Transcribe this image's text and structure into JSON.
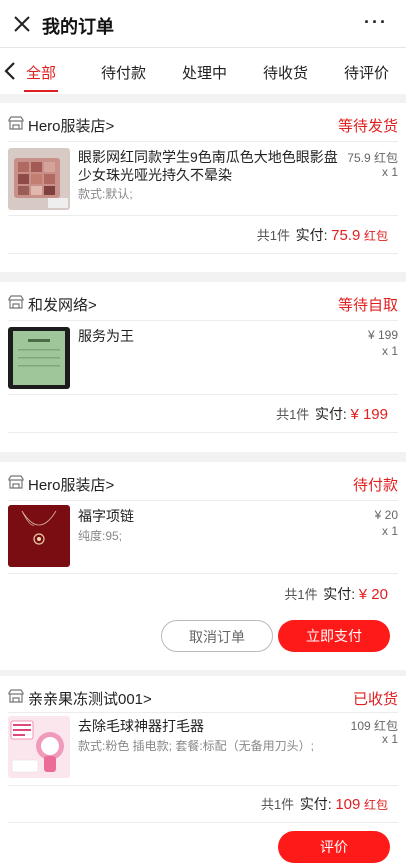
{
  "header": {
    "title": "我的订单",
    "close_icon": "close-icon",
    "more_label": "···"
  },
  "tabs": {
    "back_icon": "chevron-left-icon",
    "items": [
      {
        "label": "全部",
        "active": true
      },
      {
        "label": "待付款",
        "active": false
      },
      {
        "label": "处理中",
        "active": false
      },
      {
        "label": "待收货",
        "active": false
      },
      {
        "label": "待评价",
        "active": false
      }
    ]
  },
  "orders": [
    {
      "shop": "Hero服装店>",
      "status": "等待发货",
      "product": "眼影网红同款学生9色南瓜色大地色眼影盘少女珠光哑光持久不晕染",
      "attr": "款式:默认;",
      "price": "75.9 红包",
      "qty": "x 1",
      "count": "共1件",
      "paid_label": "实付:",
      "amount": "75.9",
      "unit": "红包"
    },
    {
      "shop": "和发网络>",
      "status": "等待自取",
      "product": "服务为王",
      "attr": "",
      "price": "¥ 199",
      "qty": "x 1",
      "count": "共1件",
      "paid_label": "实付:",
      "amount": "¥ 199",
      "unit": ""
    },
    {
      "shop": "Hero服装店>",
      "status": "待付款",
      "product": "福字项链",
      "attr": "纯度:95;",
      "price": "¥ 20",
      "qty": "x 1",
      "count": "共1件",
      "paid_label": "实付:",
      "amount": "¥ 20",
      "unit": "",
      "buttons": {
        "cancel": "取消订单",
        "pay": "立即支付"
      }
    },
    {
      "shop": "亲亲果冻测试001>",
      "status": "已收货",
      "product": "去除毛球神器打毛器",
      "attr": "款式:粉色 插电款; 套餐:标配（无备用刀头）;",
      "price": "109 红包",
      "qty": "x 1",
      "count": "共1件",
      "paid_label": "实付:",
      "amount": "109",
      "unit": "红包",
      "buttons": {
        "review": "评价"
      }
    }
  ],
  "colors": {
    "accent": "#e02020",
    "primary_button": "#ff1a1a",
    "background": "#f2f2f2"
  }
}
